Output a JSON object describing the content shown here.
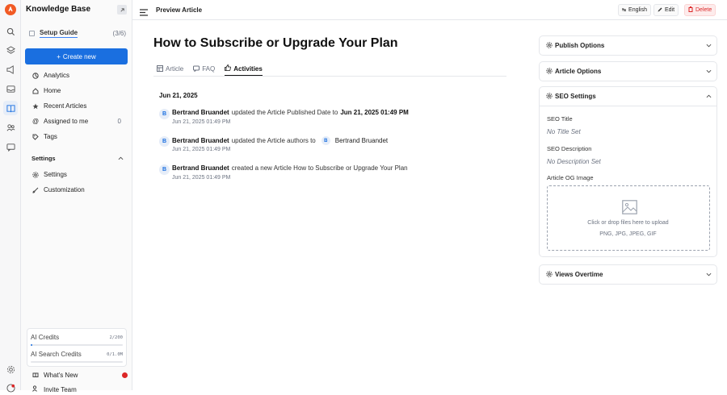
{
  "app": {
    "title": "Knowledge Base"
  },
  "sidebar": {
    "setup_guide": {
      "label": "Setup Guide",
      "count": "(3/6)"
    },
    "create_button": "Create new",
    "items": [
      {
        "label": "Analytics",
        "icon": "analytics-icon"
      },
      {
        "label": "Home",
        "icon": "home-icon"
      },
      {
        "label": "Recent Articles",
        "icon": "star-icon"
      },
      {
        "label": "Assigned to me",
        "icon": "at-icon",
        "badge": "0"
      },
      {
        "label": "Tags",
        "icon": "tag-icon"
      }
    ],
    "settings_group": {
      "title": "Settings",
      "items": [
        {
          "label": "Settings",
          "icon": "gear-icon"
        },
        {
          "label": "Customization",
          "icon": "brush-icon"
        }
      ]
    },
    "credits": [
      {
        "label": "AI Credits",
        "value": "2/200",
        "fraction": 0.01
      },
      {
        "label": "AI Search Credits",
        "value": "0/1.0M",
        "fraction": 0.0
      }
    ],
    "whats_new": "What's New",
    "invite_team": "Invite Team"
  },
  "topbar": {
    "breadcrumb": "Preview Article",
    "language_button": "English",
    "edit_button": "Edit",
    "delete_button": "Delete"
  },
  "article": {
    "title": "How to Subscribe or Upgrade Your Plan",
    "tabs": [
      {
        "label": "Article",
        "active": false
      },
      {
        "label": "FAQ",
        "active": false
      },
      {
        "label": "Activities",
        "active": true
      }
    ],
    "date_header": "Jun 21, 2025",
    "activities": [
      {
        "avatar": "B",
        "actor": "Bertrand Bruandet",
        "action": "updated the Article Published Date to",
        "target": "Jun 21, 2025 01:49 PM",
        "time": "Jun 21, 2025 01:49 PM"
      },
      {
        "avatar": "B",
        "actor": "Bertrand Bruandet",
        "action": "updated the Article authors to",
        "target_avatar": "B",
        "target": "Bertrand Bruandet",
        "time": "Jun 21, 2025 01:49 PM"
      },
      {
        "avatar": "B",
        "actor": "Bertrand Bruandet",
        "action": "created a new Article How to Subscribe or Upgrade Your Plan",
        "time": "Jun 21, 2025 01:49 PM"
      }
    ]
  },
  "right_panel": {
    "publish_options": "Publish Options",
    "article_options": "Article Options",
    "seo_settings": {
      "title": "SEO Settings",
      "seo_title_label": "SEO Title",
      "seo_title_value": "No Title Set",
      "seo_description_label": "SEO Description",
      "seo_description_value": "No Description Set",
      "og_image_label": "Article OG Image",
      "upload_text": "Click or drop files here to upload",
      "upload_formats": "PNG, JPG, JPEG, GIF"
    },
    "views_overtime": "Views Overtime"
  },
  "colors": {
    "primary": "#1a6fe0",
    "danger": "#dc2626",
    "brand": "#f15a24"
  }
}
